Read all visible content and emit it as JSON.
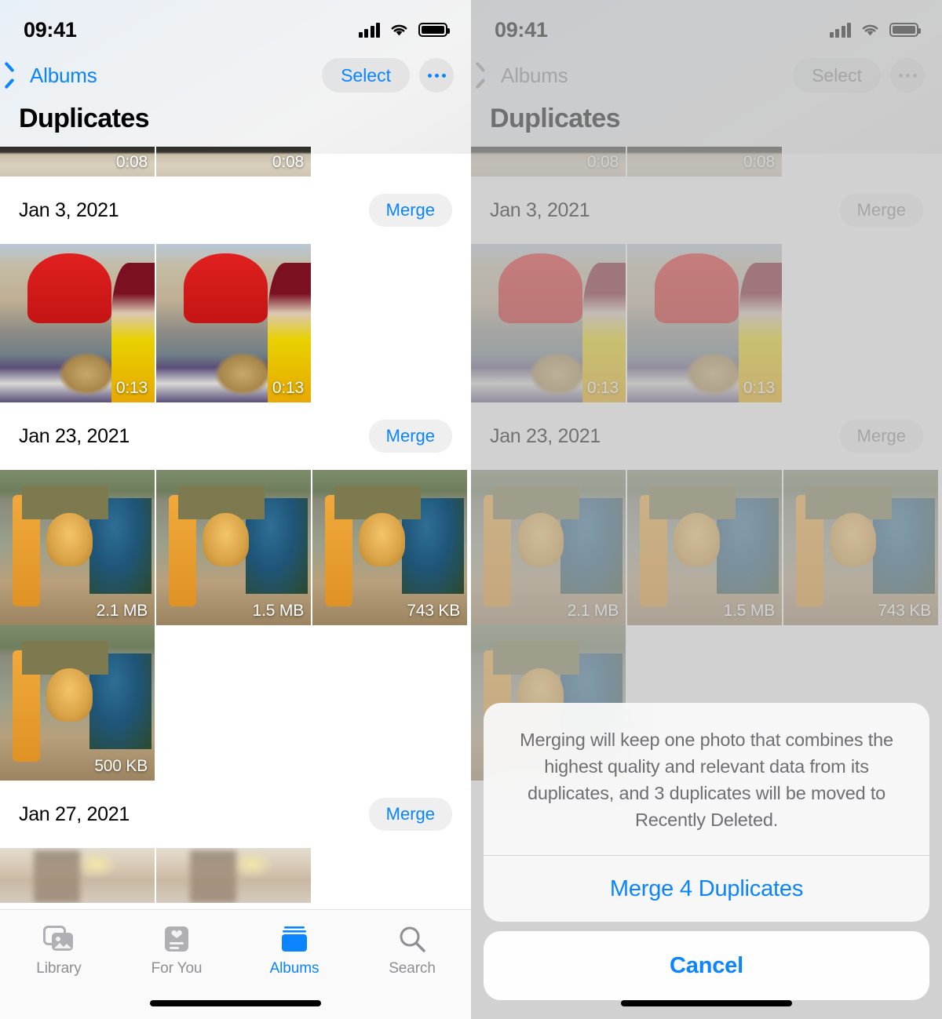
{
  "statusbar": {
    "time": "09:41",
    "signal_icon": "cellular-bars-icon",
    "wifi_icon": "wifi-icon",
    "battery_icon": "battery-full-icon"
  },
  "colors": {
    "accent": "#0a84ff",
    "pill_bg": "#e3e3e6",
    "dim_overlay": "#c8c8c8",
    "dialog_text": "#6e6e73"
  },
  "left_screen": {
    "nav": {
      "back_label": "Albums",
      "select_label": "Select",
      "more_label": "More options"
    },
    "title": "Duplicates",
    "groups": [
      {
        "date": "",
        "merge_label": "",
        "thumbs": [
          {
            "label": "0:08",
            "art": "road"
          },
          {
            "label": "0:08",
            "art": "road"
          }
        ]
      },
      {
        "date": "Jan 3, 2021",
        "merge_label": "Merge",
        "thumbs": [
          {
            "label": "0:13",
            "art": "hat"
          },
          {
            "label": "0:13",
            "art": "hat"
          }
        ]
      },
      {
        "date": "Jan 23, 2021",
        "merge_label": "Merge",
        "thumbs": [
          {
            "label": "2.1 MB",
            "art": "yoda"
          },
          {
            "label": "1.5 MB",
            "art": "yoda"
          },
          {
            "label": "743 KB",
            "art": "yoda"
          },
          {
            "label": "500 KB",
            "art": "yoda"
          }
        ]
      },
      {
        "date": "Jan 27, 2021",
        "merge_label": "Merge",
        "thumbs": [
          {
            "label": "",
            "art": "blur"
          },
          {
            "label": "",
            "art": "blur"
          }
        ]
      }
    ],
    "tabs": [
      {
        "label": "Library",
        "icon": "photos-library-icon",
        "active": false
      },
      {
        "label": "For You",
        "icon": "for-you-card-icon",
        "active": false
      },
      {
        "label": "Albums",
        "icon": "albums-stack-icon",
        "active": true
      },
      {
        "label": "Search",
        "icon": "magnifier-icon",
        "active": false
      }
    ]
  },
  "right_screen": {
    "nav": {
      "back_label": "Albums",
      "select_label": "Select",
      "more_label": "More options"
    },
    "title": "Duplicates",
    "groups": [
      {
        "date": "",
        "merge_label": "",
        "thumbs": [
          {
            "label": "0:08",
            "art": "road"
          },
          {
            "label": "0:08",
            "art": "road"
          }
        ]
      },
      {
        "date": "Jan 3, 2021",
        "merge_label": "Merge",
        "thumbs": [
          {
            "label": "0:13",
            "art": "hat"
          },
          {
            "label": "0:13",
            "art": "hat"
          }
        ]
      },
      {
        "date": "Jan 23, 2021",
        "merge_label": "Merge",
        "thumbs": [
          {
            "label": "2.1 MB",
            "art": "yoda"
          },
          {
            "label": "1.5 MB",
            "art": "yoda"
          },
          {
            "label": "743 KB",
            "art": "yoda"
          },
          {
            "label": "500 KB",
            "art": "yoda"
          }
        ]
      }
    ],
    "dialog": {
      "message": "Merging will keep one photo that combines the highest quality and relevant data from its duplicates, and 3 duplicates will be moved to Recently Deleted.",
      "confirm_label": "Merge 4 Duplicates",
      "cancel_label": "Cancel"
    }
  }
}
